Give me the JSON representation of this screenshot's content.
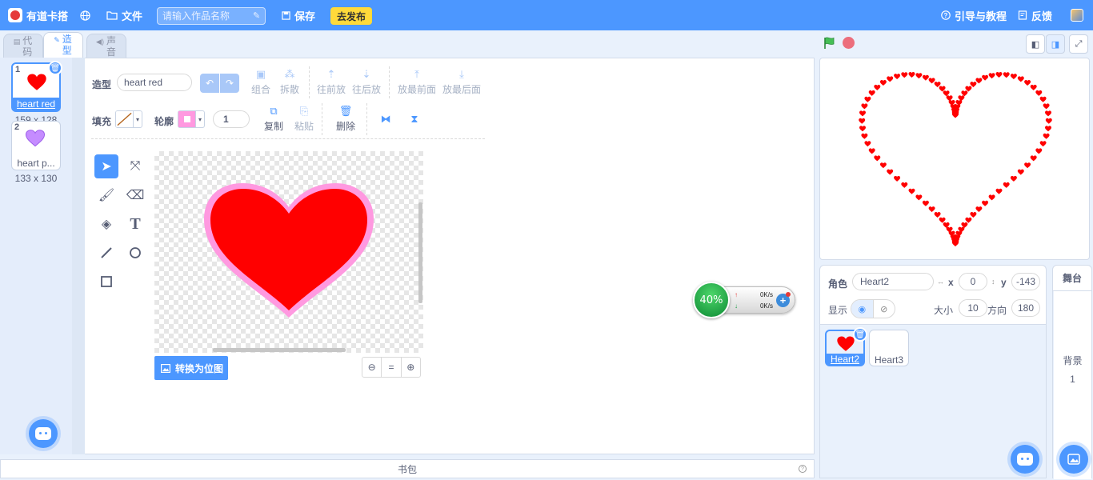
{
  "topbar": {
    "logo_text": "有道卡搭",
    "file_menu": "文件",
    "title_placeholder": "请输入作品名称",
    "save_label": "保存",
    "publish_label": "去发布",
    "guide_label": "引导与教程",
    "feedback_label": "反馈"
  },
  "tabs": {
    "code": "代码",
    "costume": "造型",
    "sound": "声音"
  },
  "costumes": [
    {
      "num": "1",
      "name": "heart red",
      "size": "159 x 128",
      "color": "#ff0000",
      "selected": true
    },
    {
      "num": "2",
      "name": "heart p...",
      "size": "133 x 130",
      "color": "#c58cff",
      "selected": false
    }
  ],
  "editor": {
    "costume_label": "造型",
    "costume_name": "heart red",
    "group_label": "组合",
    "ungroup_label": "拆散",
    "forward_label": "往前放",
    "backward_label": "往后放",
    "front_label": "放最前面",
    "back_label": "放最后面",
    "fill_label": "填充",
    "outline_label": "轮廓",
    "outline_width": "1",
    "copy_label": "复制",
    "paste_label": "粘贴",
    "delete_label": "删除",
    "convert_bitmap_label": "转换为位图",
    "zoom_reset_label": "=",
    "fill_color": "#ff0000",
    "outline_color": "#ff99e0"
  },
  "net_widget": {
    "percent": "40%",
    "upload": "0K/s",
    "download": "0K/s"
  },
  "bookbag_label": "书包",
  "sprite_info": {
    "sprite_label": "角色",
    "sprite_name": "Heart2",
    "x_label": "x",
    "x_value": "0",
    "y_label": "y",
    "y_value": "-143",
    "show_label": "显示",
    "size_label": "大小",
    "size_value": "10",
    "direction_label": "方向",
    "direction_value": "180"
  },
  "sprites": [
    {
      "name": "Heart2",
      "selected": true
    },
    {
      "name": "Heart3",
      "selected": false
    }
  ],
  "stage_panel": {
    "title": "舞台",
    "backdrop_label": "背景",
    "backdrop_count": "1"
  },
  "colors": {
    "accent": "#4c97ff",
    "heart_fill": "#ff0000",
    "heart_outline": "#ff99e0",
    "publish": "#ffda3a",
    "net_green": "#1a9e45"
  }
}
